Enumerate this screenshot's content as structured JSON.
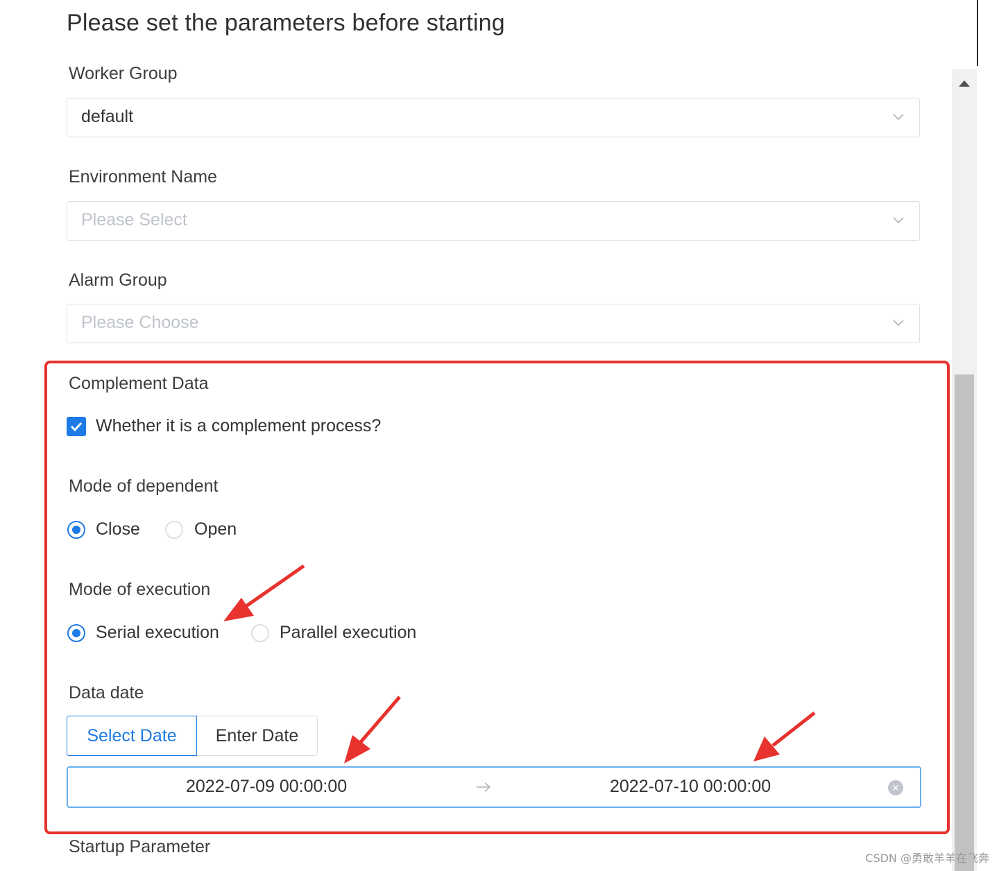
{
  "dialog": {
    "title": "Please set the parameters before starting"
  },
  "worker_group": {
    "label": "Worker Group",
    "value": "default"
  },
  "environment_name": {
    "label": "Environment Name",
    "placeholder": "Please Select"
  },
  "alarm_group": {
    "label": "Alarm Group",
    "placeholder": "Please Choose"
  },
  "complement_data": {
    "label": "Complement Data",
    "checkbox_label": "Whether it is a complement process?",
    "checked": true
  },
  "mode_of_dependent": {
    "label": "Mode of dependent",
    "options": [
      "Close",
      "Open"
    ],
    "selected": "Close"
  },
  "mode_of_execution": {
    "label": "Mode of execution",
    "options": [
      "Serial execution",
      "Parallel execution"
    ],
    "selected": "Serial execution"
  },
  "data_date": {
    "label": "Data date",
    "tabs": [
      "Select Date",
      "Enter Date"
    ],
    "active_tab": "Select Date",
    "start": "2022-07-09 00:00:00",
    "end": "2022-07-10 00:00:00"
  },
  "startup_parameter": {
    "label": "Startup Parameter"
  },
  "watermark": "CSDN @勇敢羊羊在飞奔",
  "colors": {
    "primary": "#1e7ae6",
    "annotation": "#e8322e"
  }
}
